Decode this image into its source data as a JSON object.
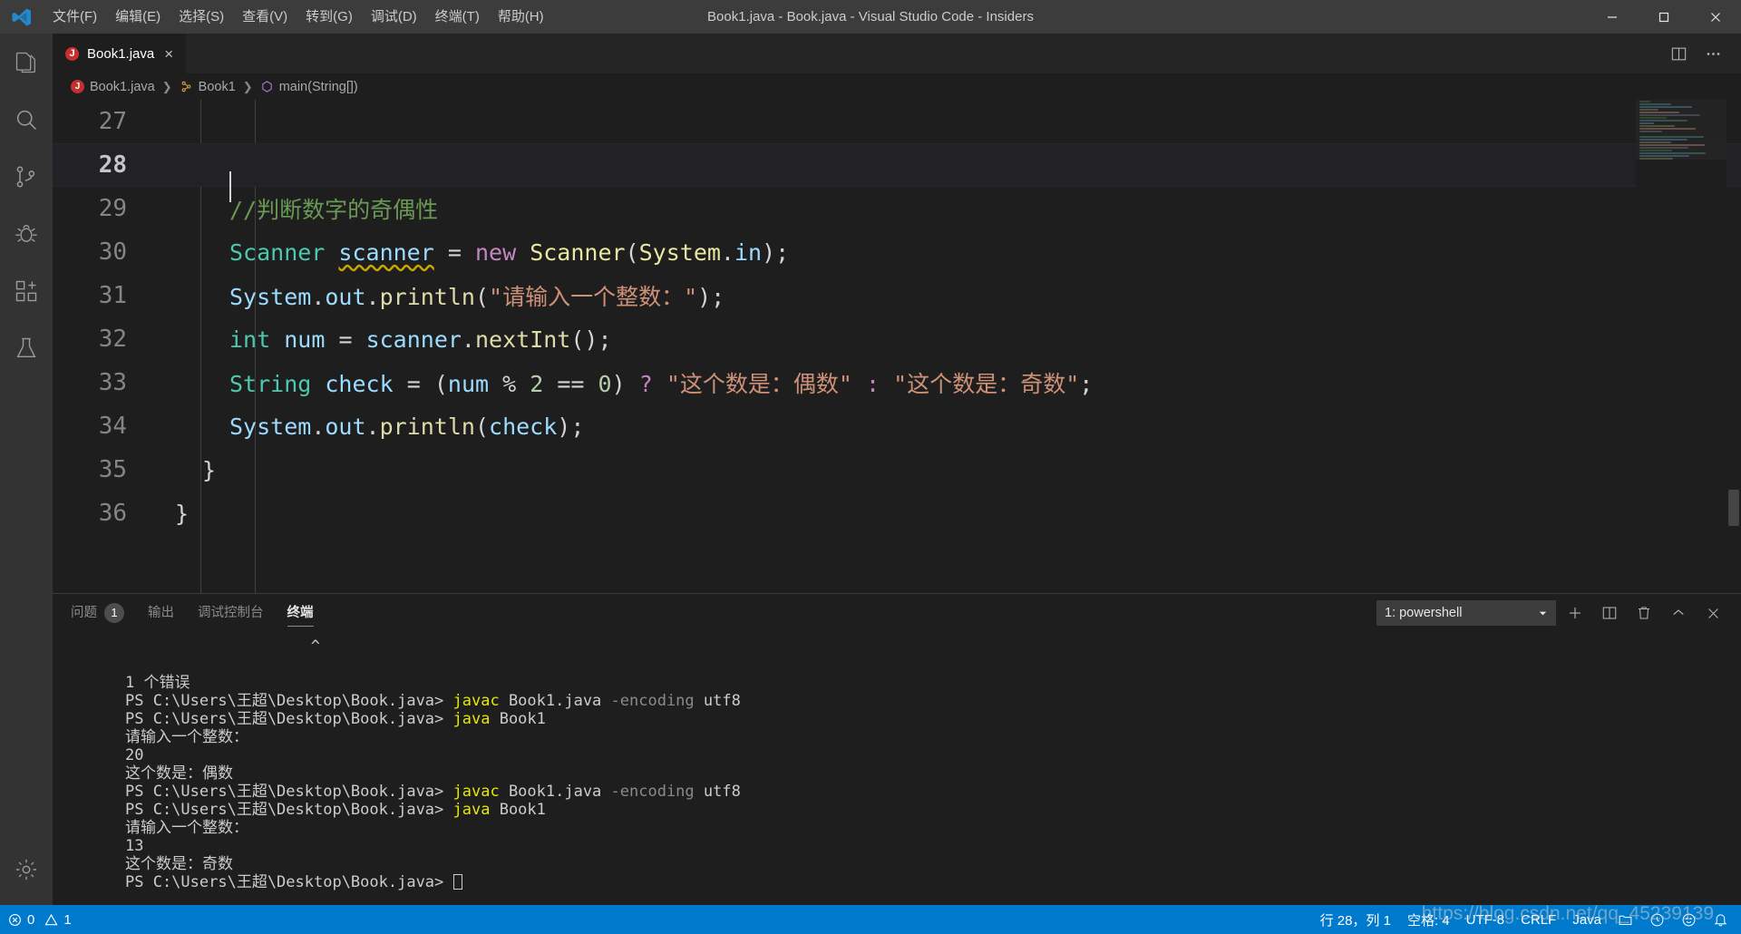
{
  "titlebar": {
    "window_title": "Book1.java - Book.java - Visual Studio Code - Insiders",
    "menu": [
      {
        "label": "文件(F)"
      },
      {
        "label": "编辑(E)"
      },
      {
        "label": "选择(S)"
      },
      {
        "label": "查看(V)"
      },
      {
        "label": "转到(G)"
      },
      {
        "label": "调试(D)"
      },
      {
        "label": "终端(T)"
      },
      {
        "label": "帮助(H)"
      }
    ],
    "controls": {
      "minimize": "minimize-icon",
      "maximize": "maximize-icon",
      "close": "close-icon"
    }
  },
  "activitybar": {
    "items": [
      {
        "name": "explorer",
        "icon": "files-icon"
      },
      {
        "name": "search",
        "icon": "search-icon"
      },
      {
        "name": "source-control",
        "icon": "source-control-icon"
      },
      {
        "name": "debug",
        "icon": "debug-icon"
      },
      {
        "name": "extensions",
        "icon": "extensions-icon"
      },
      {
        "name": "testing",
        "icon": "beaker-icon"
      }
    ],
    "bottom": [
      {
        "name": "settings",
        "icon": "gear-icon"
      }
    ]
  },
  "tabs": {
    "open": [
      {
        "label": "Book1.java",
        "icon": "java-file-icon",
        "close": "×",
        "active": true
      }
    ],
    "actions": [
      {
        "name": "split-editor",
        "icon": "split-editor-icon"
      },
      {
        "name": "more-actions",
        "icon": "ellipsis-icon"
      }
    ]
  },
  "breadcrumbs": [
    {
      "label": "Book1.java",
      "icon": "java-file-icon"
    },
    {
      "label": "Book1",
      "icon": "class-icon"
    },
    {
      "label": "main(String[])",
      "icon": "method-icon"
    }
  ],
  "editor": {
    "language": "Java",
    "lines": [
      {
        "num": "27",
        "active": false,
        "tokens": []
      },
      {
        "num": "28",
        "active": true,
        "cursor": true,
        "tokens": []
      },
      {
        "num": "29",
        "active": false,
        "tokens": [
          {
            "t": "//判断数字的奇偶性",
            "c": "t-comment"
          }
        ]
      },
      {
        "num": "30",
        "active": false,
        "tokens": [
          {
            "t": "Scanner",
            "c": "t-type"
          },
          {
            "t": " ",
            "c": "t-plain"
          },
          {
            "t": "scanner",
            "c": "t-var squiggle"
          },
          {
            "t": " ",
            "c": "t-plain"
          },
          {
            "t": "=",
            "c": "t-op"
          },
          {
            "t": " ",
            "c": "t-plain"
          },
          {
            "t": "new",
            "c": "t-kw"
          },
          {
            "t": " ",
            "c": "t-plain"
          },
          {
            "t": "Scanner",
            "c": "t-class"
          },
          {
            "t": "(",
            "c": "t-plain"
          },
          {
            "t": "System",
            "c": "t-class"
          },
          {
            "t": ".",
            "c": "t-plain"
          },
          {
            "t": "in",
            "c": "t-var"
          },
          {
            "t": ");",
            "c": "t-plain"
          }
        ]
      },
      {
        "num": "31",
        "active": false,
        "tokens": [
          {
            "t": "System",
            "c": "t-var"
          },
          {
            "t": ".",
            "c": "t-plain"
          },
          {
            "t": "out",
            "c": "t-var"
          },
          {
            "t": ".",
            "c": "t-plain"
          },
          {
            "t": "println",
            "c": "t-fn"
          },
          {
            "t": "(",
            "c": "t-plain"
          },
          {
            "t": "\"请输入一个整数：\"",
            "c": "t-str"
          },
          {
            "t": ");",
            "c": "t-plain"
          }
        ]
      },
      {
        "num": "32",
        "active": false,
        "tokens": [
          {
            "t": "int",
            "c": "t-type"
          },
          {
            "t": " ",
            "c": "t-plain"
          },
          {
            "t": "num",
            "c": "t-var"
          },
          {
            "t": " ",
            "c": "t-plain"
          },
          {
            "t": "=",
            "c": "t-op"
          },
          {
            "t": " ",
            "c": "t-plain"
          },
          {
            "t": "scanner",
            "c": "t-var"
          },
          {
            "t": ".",
            "c": "t-plain"
          },
          {
            "t": "nextInt",
            "c": "t-fn"
          },
          {
            "t": "();",
            "c": "t-plain"
          }
        ]
      },
      {
        "num": "33",
        "active": false,
        "tokens": [
          {
            "t": "String",
            "c": "t-type"
          },
          {
            "t": " ",
            "c": "t-plain"
          },
          {
            "t": "check",
            "c": "t-var"
          },
          {
            "t": " ",
            "c": "t-plain"
          },
          {
            "t": "=",
            "c": "t-op"
          },
          {
            "t": " ",
            "c": "t-plain"
          },
          {
            "t": "(",
            "c": "t-plain"
          },
          {
            "t": "num",
            "c": "t-var"
          },
          {
            "t": " ",
            "c": "t-plain"
          },
          {
            "t": "%",
            "c": "t-op"
          },
          {
            "t": " ",
            "c": "t-plain"
          },
          {
            "t": "2",
            "c": "t-num"
          },
          {
            "t": " ",
            "c": "t-plain"
          },
          {
            "t": "==",
            "c": "t-op"
          },
          {
            "t": " ",
            "c": "t-plain"
          },
          {
            "t": "0",
            "c": "t-num"
          },
          {
            "t": ")",
            "c": "t-plain"
          },
          {
            "t": " ",
            "c": "t-plain"
          },
          {
            "t": "?",
            "c": "t-kw"
          },
          {
            "t": " ",
            "c": "t-plain"
          },
          {
            "t": "\"这个数是：偶数\"",
            "c": "t-str"
          },
          {
            "t": " ",
            "c": "t-plain"
          },
          {
            "t": ":",
            "c": "t-kw"
          },
          {
            "t": " ",
            "c": "t-plain"
          },
          {
            "t": "\"这个数是：奇数\"",
            "c": "t-str"
          },
          {
            "t": ";",
            "c": "t-plain"
          }
        ]
      },
      {
        "num": "34",
        "active": false,
        "tokens": [
          {
            "t": "System",
            "c": "t-var"
          },
          {
            "t": ".",
            "c": "t-plain"
          },
          {
            "t": "out",
            "c": "t-var"
          },
          {
            "t": ".",
            "c": "t-plain"
          },
          {
            "t": "println",
            "c": "t-fn"
          },
          {
            "t": "(",
            "c": "t-plain"
          },
          {
            "t": "check",
            "c": "t-var"
          },
          {
            "t": ");",
            "c": "t-plain"
          }
        ]
      },
      {
        "num": "35",
        "active": false,
        "indent": 1,
        "tokens": [
          {
            "t": "}",
            "c": "t-plain"
          }
        ]
      },
      {
        "num": "36",
        "active": false,
        "indent": 0,
        "tokens": [
          {
            "t": "}",
            "c": "t-plain"
          }
        ]
      }
    ]
  },
  "panel": {
    "tabs": [
      {
        "label": "问题",
        "badge": "1",
        "active": false
      },
      {
        "label": "输出",
        "badge": null,
        "active": false
      },
      {
        "label": "调试控制台",
        "badge": null,
        "active": false
      },
      {
        "label": "终端",
        "badge": null,
        "active": true
      }
    ],
    "terminal_select": {
      "value": "1: powershell",
      "chevron": "chevron-down-icon"
    },
    "actions": [
      {
        "name": "new-terminal",
        "icon": "plus-icon"
      },
      {
        "name": "split-terminal",
        "icon": "split-icon"
      },
      {
        "name": "kill-terminal",
        "icon": "trash-icon"
      },
      {
        "name": "maximize-panel",
        "icon": "chevron-up-icon"
      },
      {
        "name": "close-panel",
        "icon": "close-icon"
      }
    ]
  },
  "terminal": {
    "lines": [
      {
        "segments": [
          {
            "t": "                    ^",
            "c": ""
          }
        ]
      },
      {
        "segments": []
      },
      {
        "segments": [
          {
            "t": "1 个错误",
            "c": ""
          }
        ]
      },
      {
        "segments": [
          {
            "t": "PS C:\\Users\\王超\\Desktop\\Book.java> ",
            "c": ""
          },
          {
            "t": "javac",
            "c": "tm-yellow"
          },
          {
            "t": " Book1.java ",
            "c": ""
          },
          {
            "t": "-encoding",
            "c": "tm-dim"
          },
          {
            "t": " utf8",
            "c": ""
          }
        ]
      },
      {
        "segments": [
          {
            "t": "PS C:\\Users\\王超\\Desktop\\Book.java> ",
            "c": ""
          },
          {
            "t": "java",
            "c": "tm-yellow"
          },
          {
            "t": " Book1",
            "c": ""
          }
        ]
      },
      {
        "segments": [
          {
            "t": "请输入一个整数：",
            "c": ""
          }
        ]
      },
      {
        "segments": [
          {
            "t": "20",
            "c": ""
          }
        ]
      },
      {
        "segments": [
          {
            "t": "这个数是：偶数",
            "c": ""
          }
        ]
      },
      {
        "segments": [
          {
            "t": "PS C:\\Users\\王超\\Desktop\\Book.java> ",
            "c": ""
          },
          {
            "t": "javac",
            "c": "tm-yellow"
          },
          {
            "t": " Book1.java ",
            "c": ""
          },
          {
            "t": "-encoding",
            "c": "tm-dim"
          },
          {
            "t": " utf8",
            "c": ""
          }
        ]
      },
      {
        "segments": [
          {
            "t": "PS C:\\Users\\王超\\Desktop\\Book.java> ",
            "c": ""
          },
          {
            "t": "java",
            "c": "tm-yellow"
          },
          {
            "t": " Book1",
            "c": ""
          }
        ]
      },
      {
        "segments": [
          {
            "t": "请输入一个整数：",
            "c": ""
          }
        ]
      },
      {
        "segments": [
          {
            "t": "13",
            "c": ""
          }
        ]
      },
      {
        "segments": [
          {
            "t": "这个数是：奇数",
            "c": ""
          }
        ]
      },
      {
        "segments": [
          {
            "t": "PS C:\\Users\\王超\\Desktop\\Book.java> ",
            "c": ""
          }
        ],
        "cursor": true
      }
    ]
  },
  "statusbar": {
    "background": "#007acc",
    "left": [
      {
        "name": "errors-warnings",
        "icon": "error-icon",
        "errors": "0",
        "warning_icon": "warning-icon",
        "warnings": "1"
      }
    ],
    "right": [
      {
        "name": "cursor-position",
        "label": "行 28，列 1"
      },
      {
        "name": "indentation",
        "label": "空格: 4"
      },
      {
        "name": "encoding",
        "label": "UTF-8"
      },
      {
        "name": "eol",
        "label": "CRLF"
      },
      {
        "name": "language-mode",
        "label": "Java"
      },
      {
        "name": "java-projects",
        "label": "",
        "icon": "folder-icon"
      },
      {
        "name": "java-status",
        "label": "",
        "icon": "clock-icon"
      },
      {
        "name": "feedback",
        "label": "",
        "icon": "smiley-icon"
      },
      {
        "name": "notifications",
        "label": "",
        "icon": "bell-icon"
      }
    ]
  },
  "watermark": {
    "text": "https://blog.csdn.net/qq_45239139"
  }
}
